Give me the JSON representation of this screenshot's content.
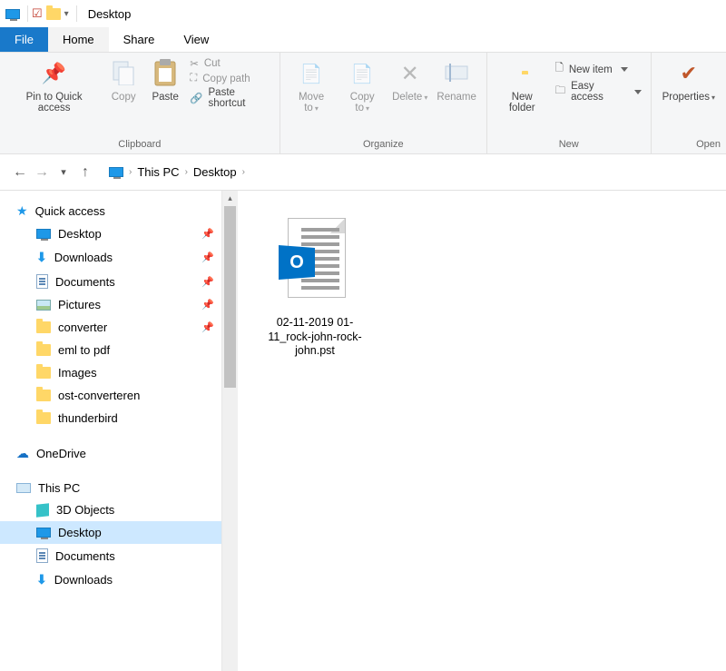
{
  "window": {
    "title": "Desktop"
  },
  "menu": {
    "file": "File",
    "home": "Home",
    "share": "Share",
    "view": "View"
  },
  "ribbon": {
    "pin": "Pin to Quick access",
    "copy": "Copy",
    "paste": "Paste",
    "cut": "Cut",
    "copy_path": "Copy path",
    "paste_shortcut": "Paste shortcut",
    "group_clipboard": "Clipboard",
    "move_to": "Move to",
    "copy_to": "Copy to",
    "delete": "Delete",
    "rename": "Rename",
    "group_organize": "Organize",
    "new_folder": "New folder",
    "new_item": "New item",
    "easy_access": "Easy access",
    "group_new": "New",
    "properties": "Properties",
    "group_open": "Open"
  },
  "nav": {
    "back": "←",
    "forward": "→",
    "up": "↑"
  },
  "breadcrumb": {
    "root": "This PC",
    "current": "Desktop"
  },
  "tree": {
    "quick_access": "Quick access",
    "onedrive": "OneDrive",
    "this_pc": "This PC",
    "qa_items": [
      {
        "label": "Desktop",
        "icon": "monitor",
        "pinned": true
      },
      {
        "label": "Downloads",
        "icon": "download",
        "pinned": true
      },
      {
        "label": "Documents",
        "icon": "doc",
        "pinned": true
      },
      {
        "label": "Pictures",
        "icon": "pic",
        "pinned": true
      },
      {
        "label": "converter",
        "icon": "folder",
        "pinned": true
      },
      {
        "label": "eml to pdf",
        "icon": "folder",
        "pinned": false
      },
      {
        "label": "Images",
        "icon": "folder",
        "pinned": false
      },
      {
        "label": "ost-converteren",
        "icon": "folder",
        "pinned": false
      },
      {
        "label": "thunderbird",
        "icon": "folder",
        "pinned": false
      }
    ],
    "pc_items": [
      {
        "label": "3D Objects",
        "icon": "3d"
      },
      {
        "label": "Desktop",
        "icon": "monitor",
        "selected": true
      },
      {
        "label": "Documents",
        "icon": "doc"
      },
      {
        "label": "Downloads",
        "icon": "download"
      }
    ]
  },
  "files": [
    {
      "name": "02-11-2019 01-11_rock-john-rock-john.pst"
    }
  ]
}
